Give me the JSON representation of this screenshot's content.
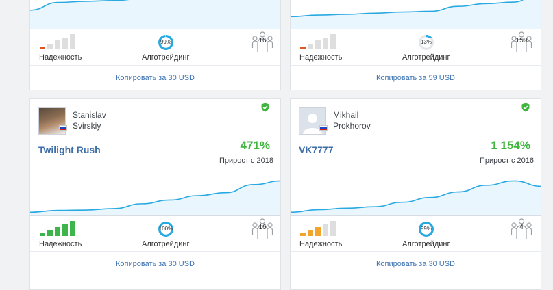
{
  "labels": {
    "reliability": "Надежность",
    "algotrading": "Алготрейдинг",
    "growth_prefix": "Прирост с "
  },
  "colors": {
    "chart_line": "#29a9e1",
    "chart_fill": "#eaf6fd",
    "growth": "#3fb43f",
    "link": "#3e74b3",
    "rel_red": "#e2541e",
    "rel_orange": "#f2a52c",
    "rel_green": "#3db54a",
    "rel_empty": "#dedede",
    "algo_ring": "#29a9e1"
  },
  "cards": [
    {
      "reliability_level": 1,
      "reliability_color": "red",
      "algotrading": "99%",
      "algotrading_fraction": 0.99,
      "subscribers": "16",
      "copy_label": "Копировать за 30 USD",
      "curve": [
        0.55,
        0.35,
        0.32,
        0.3,
        0.25,
        0.22,
        0.2,
        0.15,
        0.1,
        0.02
      ]
    },
    {
      "reliability_level": 1,
      "reliability_color": "red",
      "algotrading": "13%",
      "algotrading_fraction": 0.13,
      "subscribers": "150",
      "copy_label": "Копировать за 59 USD",
      "curve": [
        0.72,
        0.68,
        0.66,
        0.63,
        0.6,
        0.58,
        0.45,
        0.38,
        0.34,
        0.0
      ]
    },
    {
      "author_first": "Stanislav",
      "author_last": "Svirskiy",
      "avatar": "photo",
      "signal_name": "Twilight Rush",
      "growth": "471%",
      "growth_since": "2018",
      "reliability_level": 5,
      "reliability_color": "green",
      "algotrading": "100%",
      "algotrading_fraction": 1.0,
      "subscribers": "16",
      "copy_label": "Копировать за 30 USD",
      "curve": [
        0.95,
        0.9,
        0.89,
        0.85,
        0.72,
        0.62,
        0.5,
        0.42,
        0.2,
        0.1
      ]
    },
    {
      "author_first": "Mikhail",
      "author_last": "Prokhorov",
      "avatar": "placeholder",
      "signal_name": "VK7777",
      "growth": "1 154%",
      "growth_since": "2016",
      "reliability_level": 3,
      "reliability_color": "orange",
      "algotrading": "99%",
      "algotrading_fraction": 0.99,
      "subscribers": "4",
      "copy_label": "Копировать за 30 USD",
      "curve": [
        0.95,
        0.88,
        0.84,
        0.8,
        0.68,
        0.55,
        0.4,
        0.22,
        0.1,
        0.25
      ]
    }
  ]
}
